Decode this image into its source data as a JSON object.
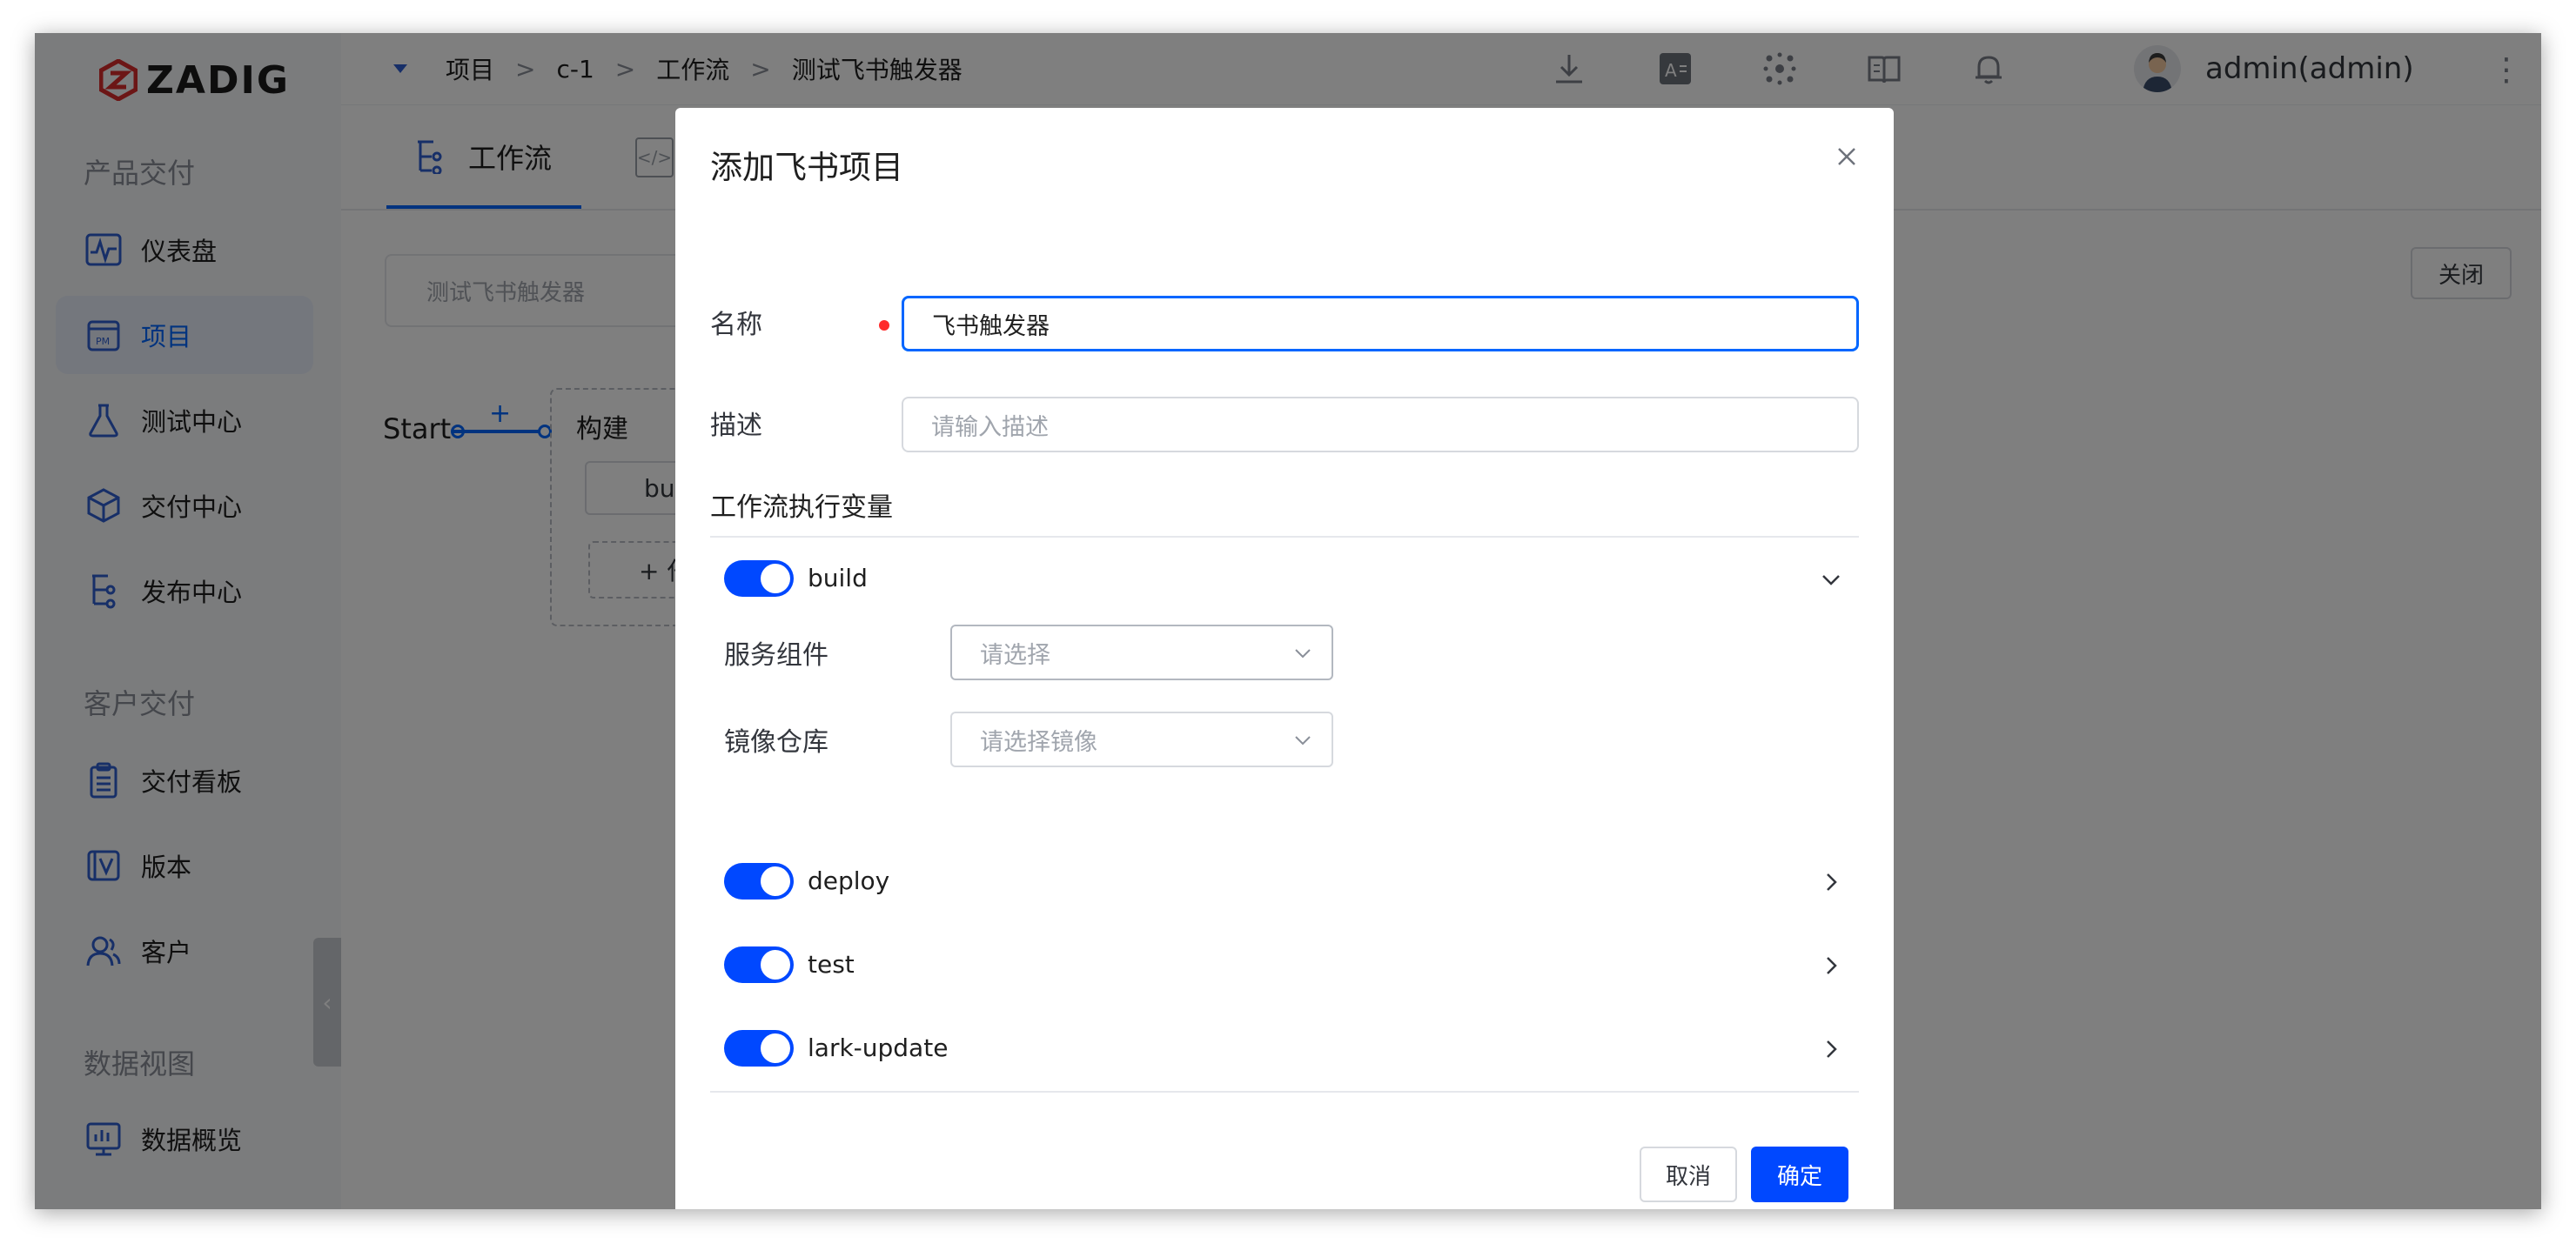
{
  "app": {
    "logo_text": "ZADIG"
  },
  "sidebar": {
    "sections": [
      {
        "title": "产品交付"
      },
      {
        "title": "客户交付"
      },
      {
        "title": "数据视图"
      }
    ],
    "items": [
      {
        "label": "仪表盘",
        "icon": "dashboard-icon"
      },
      {
        "label": "项目",
        "icon": "project-icon",
        "active": true
      },
      {
        "label": "测试中心",
        "icon": "flask-icon"
      },
      {
        "label": "交付中心",
        "icon": "box-icon"
      },
      {
        "label": "发布中心",
        "icon": "workflow-icon"
      },
      {
        "label": "交付看板",
        "icon": "clipboard-icon"
      },
      {
        "label": "版本",
        "icon": "version-icon"
      },
      {
        "label": "客户",
        "icon": "users-icon"
      },
      {
        "label": "数据概览",
        "icon": "chart-icon"
      }
    ]
  },
  "breadcrumb": [
    "项目",
    "c-1",
    "工作流",
    "测试飞书触发器"
  ],
  "breadcrumb_sep": ">",
  "user": {
    "name": "admin(admin)"
  },
  "workflow": {
    "tab_label": "工作流",
    "name_placeholder": "测试飞书触发器",
    "close_label": "关闭",
    "start_label": "Start",
    "stage_title": "构建",
    "job_label": "bui",
    "add_job_label": "+ 任"
  },
  "dialog": {
    "title": "添加飞书项目",
    "name_label": "名称",
    "name_value": "飞书触发器",
    "desc_label": "描述",
    "desc_placeholder": "请输入描述",
    "vars_title": "工作流执行变量",
    "variables": [
      {
        "name": "build",
        "enabled": true,
        "expanded": true
      },
      {
        "name": "deploy",
        "enabled": true,
        "expanded": false
      },
      {
        "name": "test",
        "enabled": true,
        "expanded": false
      },
      {
        "name": "lark-update",
        "enabled": true,
        "expanded": false
      }
    ],
    "build_fields": {
      "service_label": "服务组件",
      "service_placeholder": "请选择",
      "registry_label": "镜像仓库",
      "registry_placeholder": "请选择镜像"
    },
    "cancel_label": "取消",
    "ok_label": "确定"
  },
  "colors": {
    "primary": "#0048ff",
    "accent": "#0066ff",
    "required": "#ff2b2b",
    "logo_red": "#d92d2d"
  }
}
